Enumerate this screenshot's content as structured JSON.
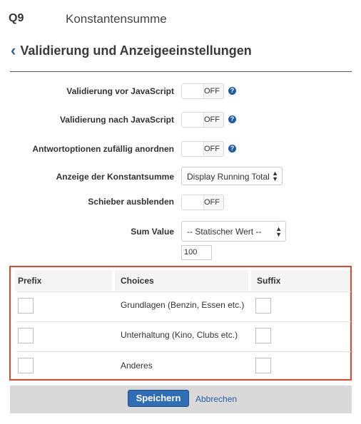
{
  "header": {
    "question_number": "Q9",
    "question_title": "Konstantensumme",
    "section_title": "Validierung und Anzeigeeinstellungen"
  },
  "settings": {
    "validation_before": {
      "label": "Validierung vor JavaScript",
      "state": "OFF"
    },
    "validation_after": {
      "label": "Validierung nach JavaScript",
      "state": "OFF"
    },
    "randomize": {
      "label": "Antwortoptionen zufällig anordnen",
      "state": "OFF"
    },
    "display_total": {
      "label": "Anzeige der Konstantsumme",
      "value": "Display Running Total"
    },
    "hide_slider": {
      "label": "Schieber ausblenden",
      "state": "OFF"
    },
    "sum_value": {
      "label": "Sum Value",
      "value": "-- Statischer Wert --",
      "amount": "100"
    }
  },
  "table": {
    "headers": [
      "Prefix",
      "Choices",
      "Suffix"
    ],
    "rows": [
      {
        "choice": "Grundlagen (Benzin, Essen etc.)"
      },
      {
        "choice": "Unterhaltung (Kino, Clubs etc.)"
      },
      {
        "choice": "Anderes"
      }
    ]
  },
  "footer": {
    "save_label": "Speichern",
    "cancel_label": "Abbrechen"
  },
  "colors": {
    "accent": "#2f6db5",
    "highlight_border": "#e5462b"
  }
}
